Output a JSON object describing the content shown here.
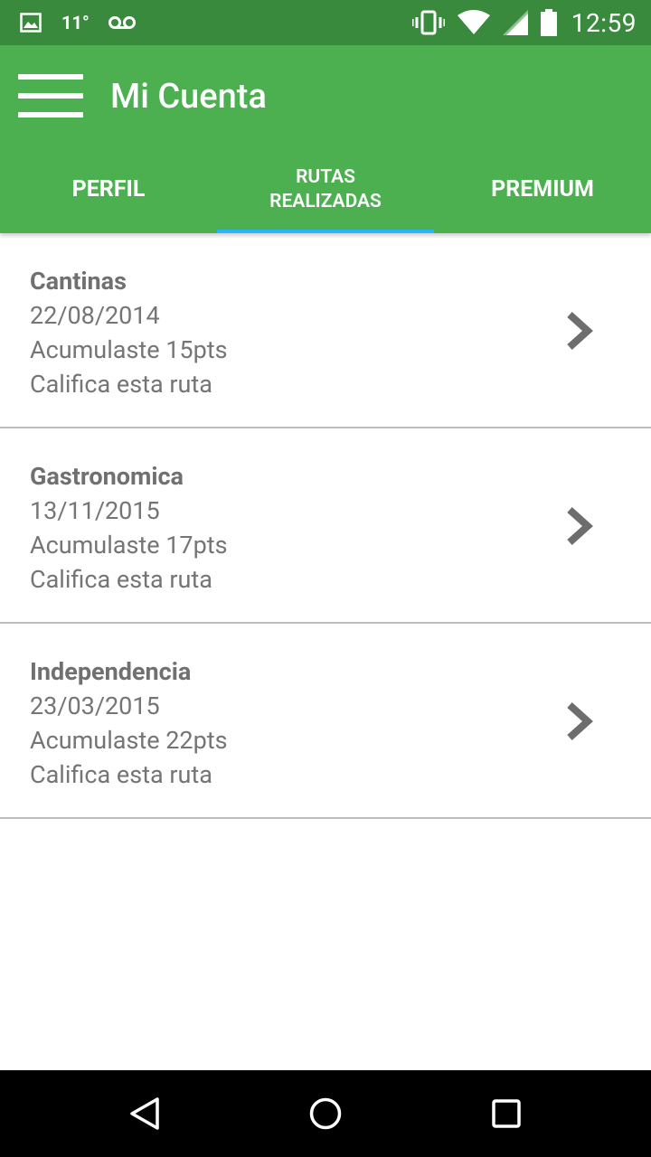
{
  "status_bar": {
    "temperature": "11°",
    "time": "12:59",
    "icons": [
      "image-notification-icon",
      "voicemail-icon",
      "vibrate-icon",
      "wifi-icon",
      "signal-icon",
      "battery-icon"
    ],
    "color": "#3a8a3d"
  },
  "app_bar": {
    "title": "Mi Cuenta",
    "menu_icon": "hamburger-menu-icon",
    "color": "#4caf50"
  },
  "tabs": [
    {
      "label": "PERFIL",
      "selected": false
    },
    {
      "label": "RUTAS REALIZADAS",
      "selected": true
    },
    {
      "label": "PREMIUM",
      "selected": false
    }
  ],
  "tab_indicator_color": "#29b6f6",
  "routes": [
    {
      "name": "Cantinas",
      "date": "22/08/2014",
      "points": "Acumulaste 15pts",
      "rate": "Califica esta ruta",
      "icon": "chevron-right-icon"
    },
    {
      "name": "Gastronomica",
      "date": "13/11/2015",
      "points": "Acumulaste 17pts",
      "rate": "Califica esta ruta",
      "icon": "chevron-right-icon"
    },
    {
      "name": "Independencia",
      "date": "23/03/2015",
      "points": "Acumulaste 22pts",
      "rate": "Califica esta ruta",
      "icon": "chevron-right-icon"
    }
  ],
  "nav_bar": {
    "icons": [
      "back-icon",
      "home-icon",
      "recents-icon"
    ]
  }
}
